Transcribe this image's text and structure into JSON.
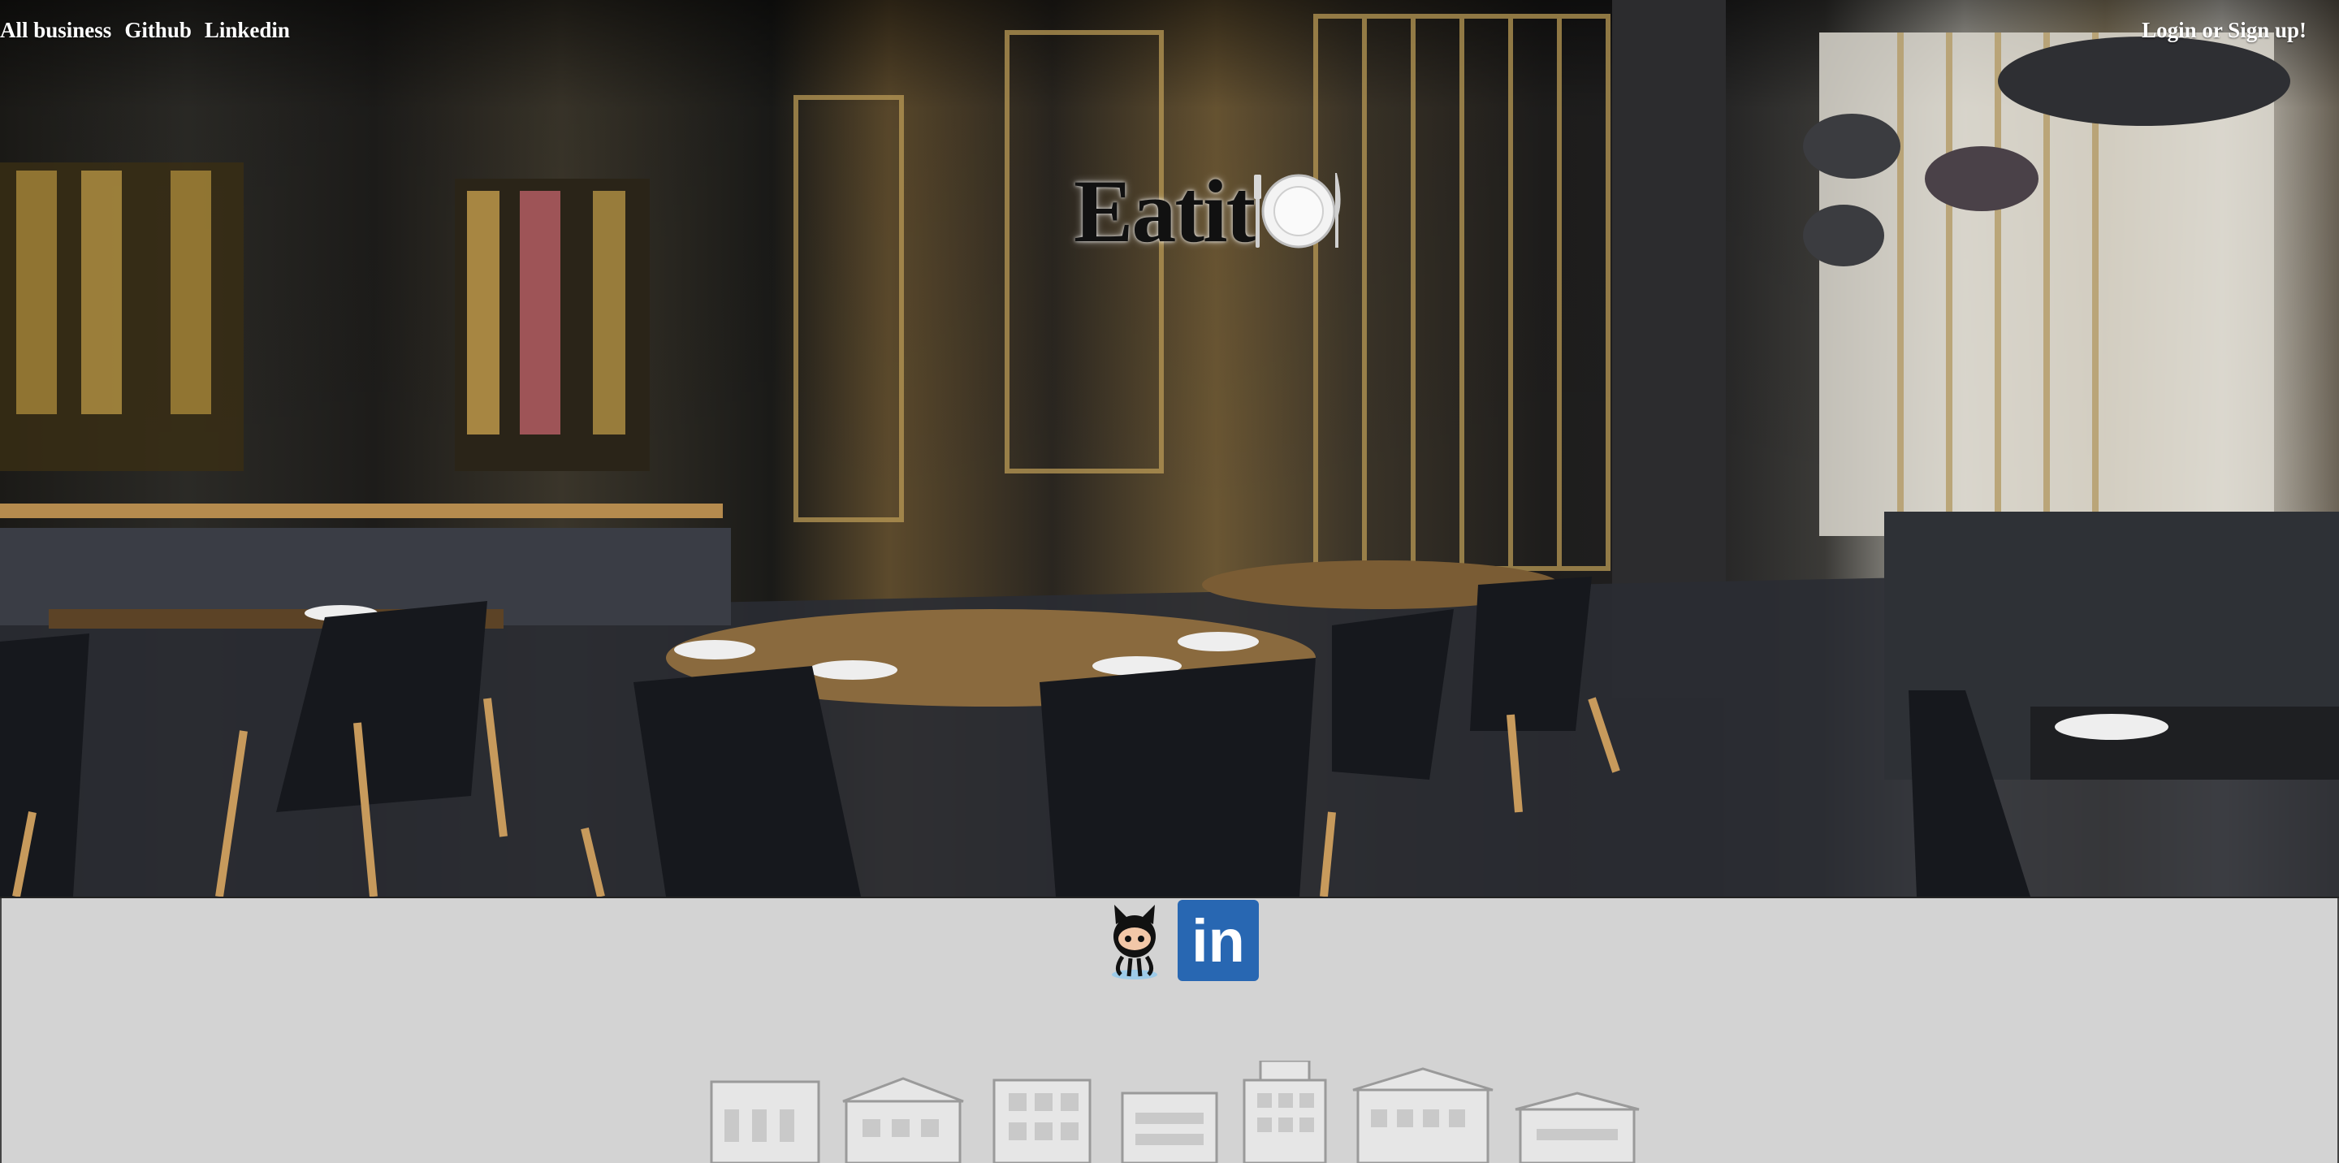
{
  "nav": {
    "all_business": "All business",
    "github": "Github",
    "linkedin": "Linkedin",
    "login": "Login or Sign up!"
  },
  "logo": {
    "text": "Eatit",
    "icon": "plate-fork-knife-icon"
  },
  "footer": {
    "github_icon": "github-octocat-icon",
    "linkedin_icon": "linkedin-icon",
    "linkedin_glyph": "in",
    "illustration": "storefronts-illustration"
  },
  "colors": {
    "nav_text": "#ffffff",
    "footer_bg": "#d3d3d3",
    "linkedin_blue": "#2867b2",
    "logo_text": "#111111"
  }
}
